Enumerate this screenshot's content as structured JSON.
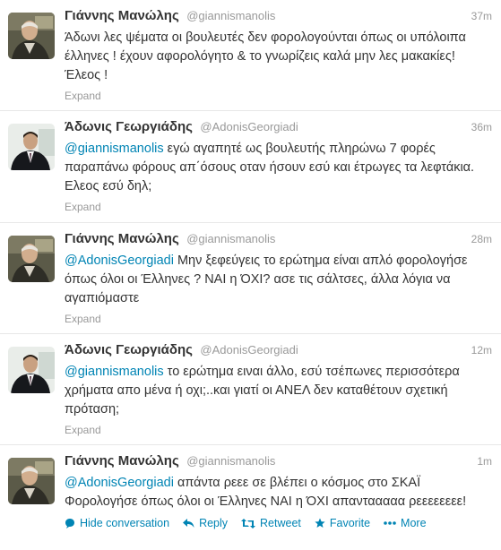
{
  "tweets": [
    {
      "fullname": "Γιάννης Μανώλης",
      "username": "@giannismanolis",
      "time": "37m",
      "mention": "",
      "text": "Άδωνι λες ψέματα οι βουλευτές δεν φορολογούνται όπως οι υπόλοιπα έλληνες ! έχουν αφορολόγητο & το γνωρίζεις καλά μην λες μακακίες! Έλεος !",
      "expand": "Expand",
      "avatar_icon": "avatar-manolis"
    },
    {
      "fullname": "Άδωνις Γεωργιάδης",
      "username": "@AdonisGeorgiadi",
      "time": "36m",
      "mention": "@giannismanolis",
      "text": " εγώ αγαπητέ ως βουλευτής πληρώνω 7 φορές παραπάνω φόρους απ΄όσους οταν ήσουν εσύ και έτρωγες τα λεφτάκια. Ελεος εσύ δηλ;",
      "expand": "Expand",
      "avatar_icon": "avatar-georgiadis"
    },
    {
      "fullname": "Γιάννης Μανώλης",
      "username": "@giannismanolis",
      "time": "28m",
      "mention": "@AdonisGeorgiadi",
      "text": " Μην ξεφεύγεις το ερώτημα είναι απλό φορολογήσε όπως όλοι οι Έλληνες ? ΝΑΙ η ΌΧΙ? ασε τις σάλτσες, άλλα λόγια να αγαπιόμαστε",
      "expand": "Expand",
      "avatar_icon": "avatar-manolis"
    },
    {
      "fullname": "Άδωνις Γεωργιάδης",
      "username": "@AdonisGeorgiadi",
      "time": "12m",
      "mention": "@giannismanolis",
      "text": " το ερώτημα ειναι άλλο, εσύ τσέπωνες περισσότερα χρήματα απο μένα ή οχι;..και γιατί οι ΑΝΕΛ δεν καταθέτουν σχετική πρόταση;",
      "expand": "Expand",
      "avatar_icon": "avatar-georgiadis"
    },
    {
      "fullname": "Γιάννης Μανώλης",
      "username": "@giannismanolis",
      "time": "1m",
      "mention": "@AdonisGeorgiadi",
      "text": " απάντα ρεεε σε βλέπει ο κόσμος στο ΣΚΑΪ Φορολογήσε όπως όλοι οι Έλληνες ΝΑΙ η ΌΧΙ απαντααααα ρεεεεεεεε!",
      "avatar_icon": "avatar-manolis",
      "actions": {
        "hide_conversation": "Hide conversation",
        "reply": "Reply",
        "retweet": "Retweet",
        "favorite": "Favorite",
        "more": "More"
      }
    }
  ],
  "colors": {
    "link": "#0084b4",
    "muted": "#999999",
    "text": "#333333",
    "divider": "#e8e8e8"
  }
}
